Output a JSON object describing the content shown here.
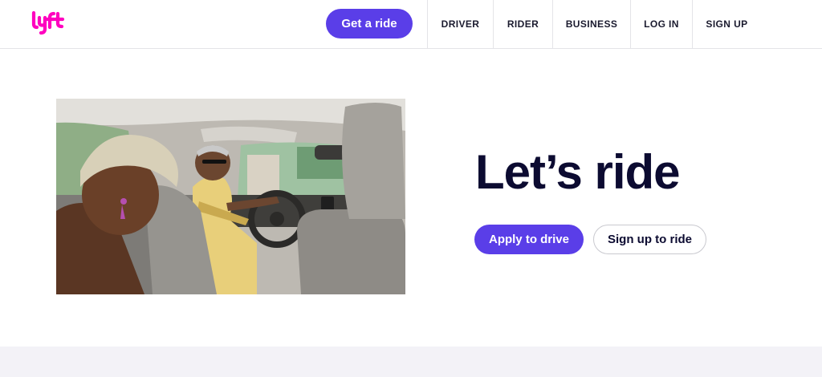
{
  "brand": {
    "logo_text": "lyft",
    "accent_color": "#ff00bf",
    "primary_color": "#5a3ee8"
  },
  "header": {
    "cta_label": "Get a ride",
    "nav": [
      {
        "label": "DRIVER"
      },
      {
        "label": "RIDER"
      },
      {
        "label": "BUSINESS"
      },
      {
        "label": "LOG IN"
      },
      {
        "label": "SIGN UP"
      }
    ]
  },
  "hero": {
    "image_icon": "photo-passenger-and-driver-in-car",
    "headline": "Let’s ride",
    "primary_button": "Apply to drive",
    "secondary_button": "Sign up to ride"
  }
}
